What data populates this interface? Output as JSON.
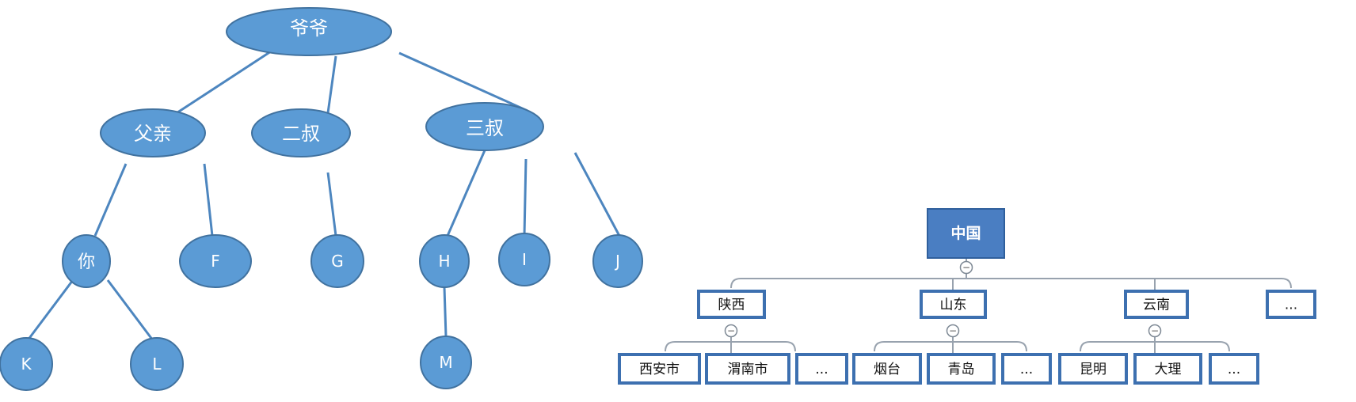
{
  "family_tree": {
    "nodes": {
      "grandpa": "爷爷",
      "father": "父亲",
      "uncle2": "二叔",
      "uncle3": "三叔",
      "you": "你",
      "f": "F",
      "g": "G",
      "h": "H",
      "i": "I",
      "j": "J",
      "k": "K",
      "l": "L",
      "m": "M"
    },
    "edges": [
      [
        "grandpa",
        "father"
      ],
      [
        "grandpa",
        "uncle2"
      ],
      [
        "grandpa",
        "uncle3"
      ],
      [
        "father",
        "you"
      ],
      [
        "father",
        "f"
      ],
      [
        "uncle2",
        "g"
      ],
      [
        "uncle3",
        "h"
      ],
      [
        "uncle3",
        "i"
      ],
      [
        "uncle3",
        "j"
      ],
      [
        "you",
        "k"
      ],
      [
        "you",
        "l"
      ],
      [
        "h",
        "m"
      ]
    ]
  },
  "region_tree": {
    "nodes": {
      "china": "中国",
      "shaanxi": "陕西",
      "shandong": "山东",
      "yunnan": "云南",
      "more1": "...",
      "xian": "西安市",
      "weinan": "渭南市",
      "more2": "...",
      "yantai": "烟台",
      "qingdao": "青岛",
      "more3": "...",
      "kunming": "昆明",
      "dali": "大理",
      "more4": "..."
    },
    "collapse_symbol": "−",
    "colors": {
      "root_fill": "#4a7ec2",
      "box_border": "#3d70b0",
      "connector": "#98a2ae"
    }
  },
  "colors": {
    "node_fill": "#5b9bd5",
    "node_stroke": "#41729f",
    "edge": "#4d86bf",
    "node_text": "#ffffff"
  }
}
